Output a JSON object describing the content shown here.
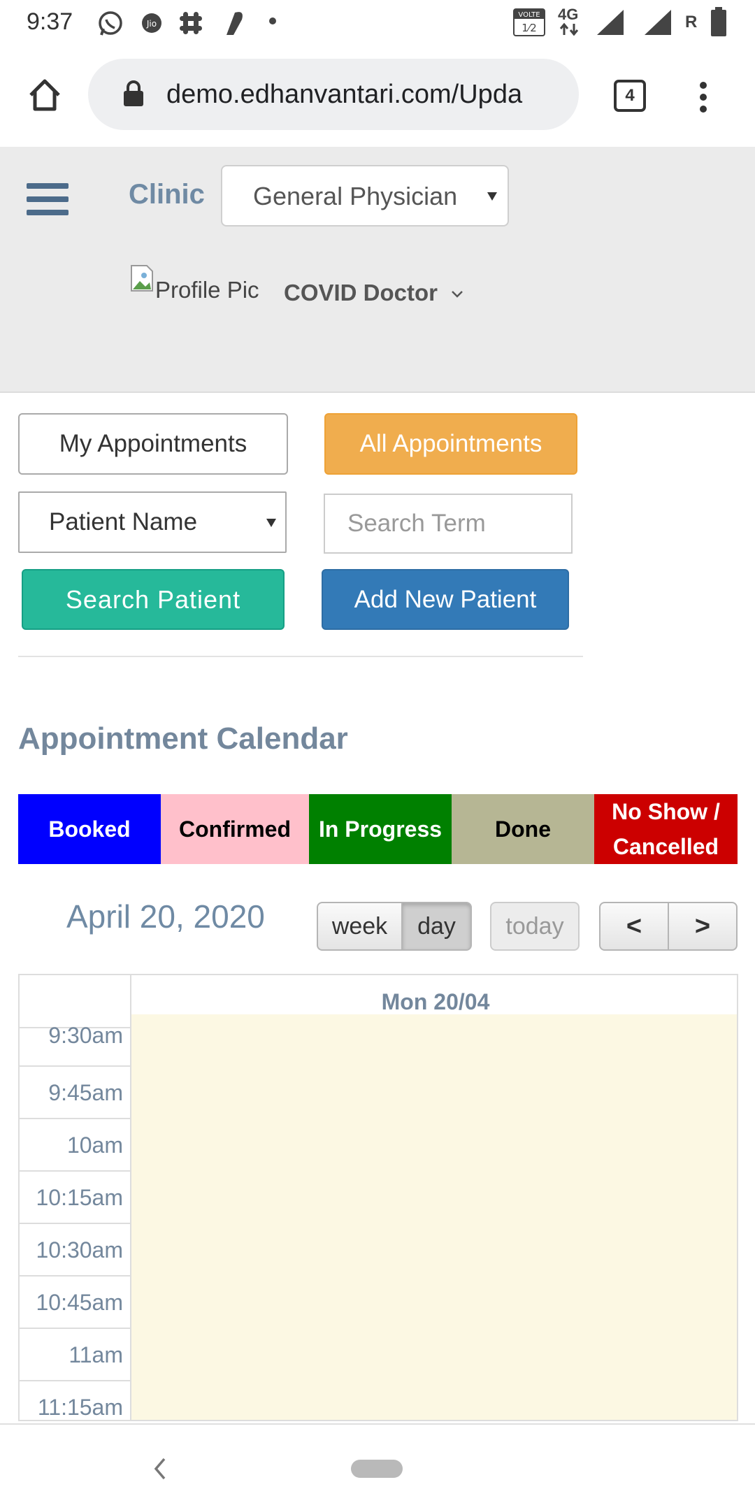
{
  "status_bar": {
    "time": "9:37",
    "icons": [
      "whatsapp-icon",
      "jio-icon",
      "slack-icon",
      "app-icon",
      "dot-icon",
      "volte-icon",
      "4g-icon",
      "signal-icon",
      "roaming-icon",
      "battery-icon"
    ],
    "network_label": "4G",
    "volte_label": "VOLTE",
    "roaming_label": "R"
  },
  "browser": {
    "url": "demo.edhanvantari.com/Upda",
    "tab_count": "4"
  },
  "header": {
    "clinic_label": "Clinic",
    "clinic_select_value": "General Physician",
    "profile_pic_alt": "Profile Pic",
    "doctor_name": "COVID Doctor"
  },
  "controls": {
    "my_appointments": "My Appointments",
    "all_appointments": "All Appointments",
    "patient_field_select": "Patient Name",
    "search_placeholder": "Search Term",
    "search_patient": "Search Patient",
    "add_new_patient": "Add New Patient"
  },
  "calendar": {
    "heading": "Appointment Calendar",
    "legend": [
      {
        "label": "Booked",
        "bg": "#0000ff",
        "fg": "#ffffff"
      },
      {
        "label": "Confirmed",
        "bg": "#ffc0cb",
        "fg": "#000000"
      },
      {
        "label": "In Progress",
        "bg": "#008000",
        "fg": "#ffffff"
      },
      {
        "label": "Done",
        "bg": "#b6b694",
        "fg": "#000000"
      },
      {
        "label": "No Show / Cancelled",
        "bg": "#cc0000",
        "fg": "#ffffff"
      }
    ],
    "date_title": "April 20, 2020",
    "view_week": "week",
    "view_day": "day",
    "today": "today",
    "prev": "<",
    "next": ">",
    "day_header": "Mon 20/04",
    "time_slots": [
      "9:30am",
      "9:45am",
      "10am",
      "10:15am",
      "10:30am",
      "10:45am",
      "11am",
      "11:15am"
    ]
  }
}
